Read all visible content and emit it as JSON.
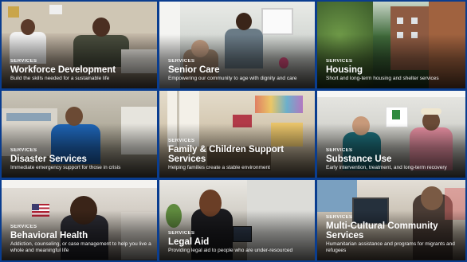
{
  "tiles": [
    {
      "kicker": "SERVICES",
      "title": "Workforce Development",
      "desc": "Build the skills needed for a sustainable life"
    },
    {
      "kicker": "SERVICES",
      "title": "Senior Care",
      "desc": "Empowering our community to age with dignity and care"
    },
    {
      "kicker": "SERVICES",
      "title": "Housing",
      "desc": "Short and long-term housing and shelter services"
    },
    {
      "kicker": "SERVICES",
      "title": "Disaster Services",
      "desc": "Immediate emergency support for those in crisis"
    },
    {
      "kicker": "SERVICES",
      "title": "Family & Children Support Services",
      "desc": "Helping families create a stable environment"
    },
    {
      "kicker": "SERVICES",
      "title": "Substance Use",
      "desc": "Early intervention, treatment, and long-term recovery"
    },
    {
      "kicker": "SERVICES",
      "title": "Behavioral Health",
      "desc": "Addiction, counseling, or case management to help you live a whole and meaningful life"
    },
    {
      "kicker": "SERVICES",
      "title": "Legal Aid",
      "desc": "Providing legal aid to people who are under-resourced"
    },
    {
      "kicker": "SERVICES",
      "title": "Multi-Cultural Community Services",
      "desc": "Humanitarian assistance and programs for migrants and refugees"
    }
  ],
  "icons": {
    "housing_logo": "house-logo-icon"
  },
  "colors": {
    "frame": "#0a3d8f",
    "text": "#ffffff"
  }
}
